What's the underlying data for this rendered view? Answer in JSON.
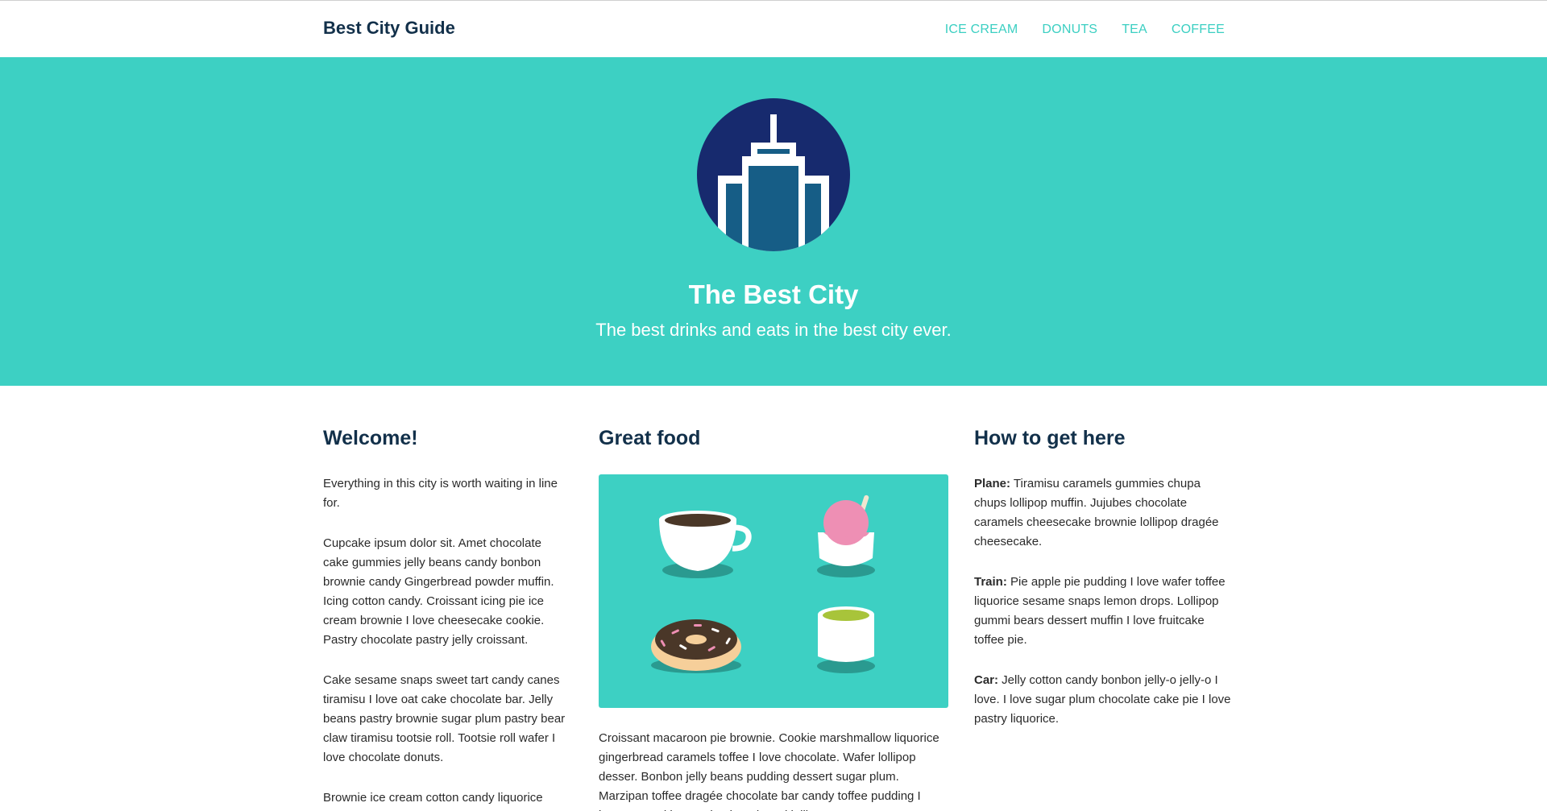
{
  "header": {
    "brand": "Best City Guide",
    "nav": [
      "ICE CREAM",
      "DONUTS",
      "TEA",
      "COFFEE"
    ]
  },
  "hero": {
    "title": "The Best City",
    "subtitle": "The best drinks and eats in the best city ever."
  },
  "columns": {
    "welcome": {
      "heading": "Welcome!",
      "paragraphs": [
        "Everything in this city is worth waiting in line for.",
        "Cupcake ipsum dolor sit. Amet chocolate cake gummies jelly beans candy bonbon brownie candy Gingerbread powder muffin. Icing cotton candy. Croissant icing pie ice cream brownie I love cheesecake cookie. Pastry chocolate pastry jelly croissant.",
        "Cake sesame snaps sweet tart candy canes tiramisu I love oat cake chocolate bar. Jelly beans pastry brownie sugar plum pastry bear claw tiramisu tootsie roll. Tootsie roll wafer I love chocolate donuts.",
        "Brownie ice cream cotton candy liquorice"
      ]
    },
    "food": {
      "heading": "Great food",
      "paragraph": "Croissant macaroon pie brownie. Cookie marshmallow liquorice gingerbread caramels toffee I love chocolate. Wafer lollipop desser. Bonbon jelly beans pudding dessert sugar plum. Marzipan toffee dragée chocolate bar candy toffee pudding I love. Gummi bears pie gingerbread lollipop."
    },
    "travel": {
      "heading": "How to get here",
      "items": [
        {
          "label": "Plane:",
          "text": " Tiramisu caramels gummies chupa chups lollipop muffin. Jujubes chocolate caramels cheesecake brownie lollipop dragée cheesecake."
        },
        {
          "label": "Train:",
          "text": " Pie apple pie pudding I love wafer toffee liquorice sesame snaps lemon drops. Lollipop gummi bears dessert muffin I love fruitcake toffee pie."
        },
        {
          "label": "Car:",
          "text": " Jelly cotton candy bonbon jelly-o jelly-o I love. I love sugar plum chocolate cake pie I love pastry liquorice."
        }
      ]
    }
  },
  "colors": {
    "accent": "#3dd0c3",
    "heading": "#12304a",
    "logo_circle": "#172a6e",
    "building": "#165d86"
  }
}
